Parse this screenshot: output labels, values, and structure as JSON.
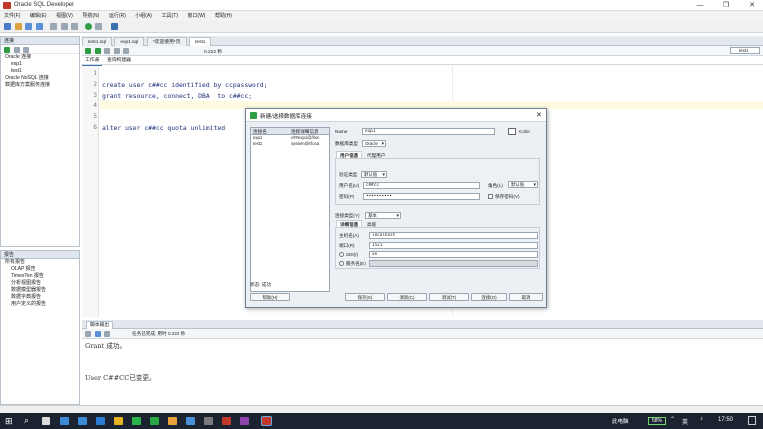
{
  "window": {
    "title": "Oracle SQL Developer",
    "minimize": "—",
    "restore": "❐",
    "close": "✕"
  },
  "menu": [
    "文件(F)",
    "编辑(E)",
    "视图(V)",
    "导航(N)",
    "运行(R)",
    "小组(A)",
    "工具(T)",
    "窗口(W)",
    "帮助(H)"
  ],
  "left_panel": {
    "title": "连接",
    "tree": [
      "Oracle 连接",
      "exp1",
      "test1",
      "Oracle NoSQL 连接",
      "数据库方案服务连接"
    ]
  },
  "report_panel": {
    "title": "报告",
    "tree": [
      "所有报告",
      "OLAP 报告",
      "TimesTen 报告",
      "分析视图报告",
      "数据模型器报告",
      "数据字典报告",
      "用户定义的报告"
    ]
  },
  "editor_tabs": [
    "test1.sql",
    "exp1.sql",
    "*欢迎使用*页",
    "test1"
  ],
  "editor": {
    "time": "0.222 秒",
    "conn_select": "test1",
    "subtabs": [
      "工作表",
      "查询构建器"
    ],
    "lines": [
      {
        "n": "1",
        "text": ""
      },
      {
        "n": "2",
        "text": "create user c##cc identified by ccpassword;"
      },
      {
        "n": "3",
        "text": "grant resource, connect, DBA  to c##cc;"
      },
      {
        "n": "4",
        "text": ""
      },
      {
        "n": "5",
        "text": ""
      },
      {
        "n": "6",
        "text": "alter user c##cc quota unlimited"
      }
    ]
  },
  "output": {
    "title": "脚本输出",
    "status": "任务已完成, 用时 0.222 秒",
    "lines": [
      "Grant 成功。",
      "User C##CC已变更。"
    ]
  },
  "dialog": {
    "title": "新建/选择数据库连接",
    "table_headers": [
      "连接名",
      "连接详细信息"
    ],
    "connections": [
      {
        "name": "exp1",
        "details": "c##exp1@//loc"
      },
      {
        "name": "test1",
        "details": "system@//loca"
      }
    ],
    "name_label": "Name",
    "name_value": "exp1",
    "color_label": "Color",
    "dbtype_label": "数据库类型",
    "dbtype_value": "Oracle",
    "user_tabs": [
      "用户信息",
      "代理用户"
    ],
    "auth_label": "验证类型",
    "auth_value": "默认值",
    "user_label": "用户名(U)",
    "user_value": "c##cc",
    "role_label": "角色(L)",
    "role_value": "默认值",
    "pwd_label": "密码(P)",
    "pwd_value": "••••••••••",
    "save_pwd": "保存密码(V)",
    "conntype_label": "连接类型(Y)",
    "conntype_value": "基本",
    "detail_tabs": [
      "详细信息",
      "高级"
    ],
    "host_label": "主机名(A)",
    "host_value": "localhost",
    "port_label": "端口(R)",
    "port_value": "1521",
    "sid_label": "SID(I)",
    "sid_value": "xe",
    "service_label": "服务名(E)",
    "status_label": "状态: 成功",
    "buttons": {
      "help": "帮助(H)",
      "save": "保存(S)",
      "clear": "清除(C)",
      "test": "测试(T)",
      "connect": "连接(O)",
      "cancel": "取消"
    }
  },
  "taskbar": {
    "tray_text": "此电脑",
    "battery": "58%",
    "ime": "英",
    "clock": "17:50"
  }
}
